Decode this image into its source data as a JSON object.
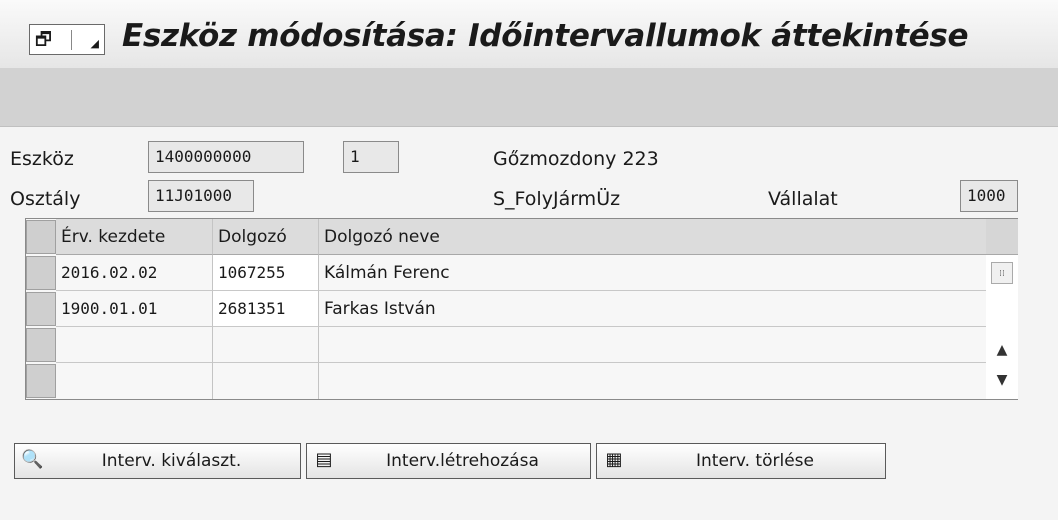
{
  "header": {
    "title": "Eszköz módosítása: Időintervallumok áttekintése"
  },
  "fields": {
    "eszkoz_label": "Eszköz",
    "eszkoz_value": "1400000000",
    "sub_value": "1",
    "description": "Gőzmozdony 223",
    "osztaly_label": "Osztály",
    "osztaly_value": "11J01000",
    "class_text": "S_FolyJármÜz",
    "vallalat_label": "Vállalat",
    "vallalat_value": "1000"
  },
  "table": {
    "columns": [
      "Érv. kezdete",
      "Dolgozó",
      "Dolgozó neve"
    ],
    "rows": [
      {
        "start": "2016.02.02",
        "worker": "1067255",
        "name": "Kálmán Ferenc"
      },
      {
        "start": "1900.01.01",
        "worker": "2681351",
        "name": "Farkas István"
      },
      {
        "start": "",
        "worker": "",
        "name": ""
      },
      {
        "start": "",
        "worker": "",
        "name": ""
      }
    ]
  },
  "buttons": {
    "select": "Interv. kiválaszt.",
    "create": "Interv.létrehozása",
    "delete": "Interv. törlése"
  }
}
